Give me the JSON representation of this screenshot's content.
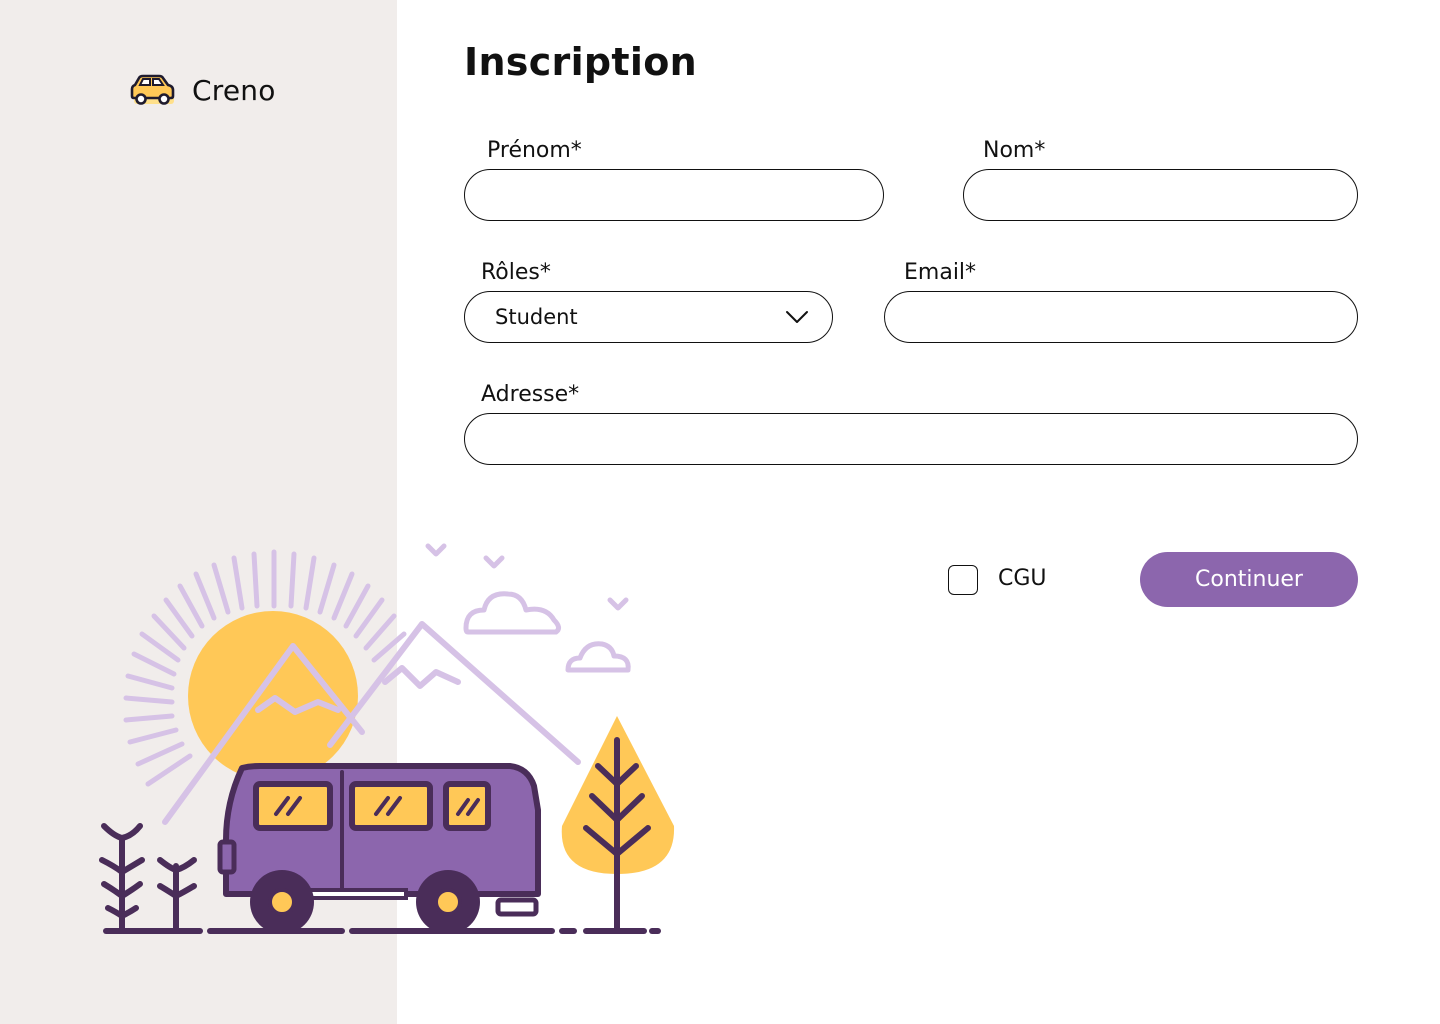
{
  "brand": {
    "name": "Creno",
    "icon": "car-icon"
  },
  "form": {
    "title": "Inscription",
    "fields": {
      "first_name": {
        "label": "Prénom*",
        "value": ""
      },
      "last_name": {
        "label": "Nom*",
        "value": ""
      },
      "roles": {
        "label": "Rôles*",
        "value": "Student",
        "icon": "chevron-down-icon"
      },
      "email": {
        "label": "Email*",
        "value": ""
      },
      "address": {
        "label": "Adresse*",
        "value": ""
      }
    },
    "terms": {
      "label": "CGU",
      "checked": false
    },
    "submit_label": "Continuer"
  },
  "colors": {
    "sidebar_bg": "#f1edeb",
    "accent_purple": "#8c66ad",
    "accent_yellow": "#ffc857",
    "illustration_lilac": "#d6c2e6",
    "illustration_dark": "#4a2d59"
  }
}
